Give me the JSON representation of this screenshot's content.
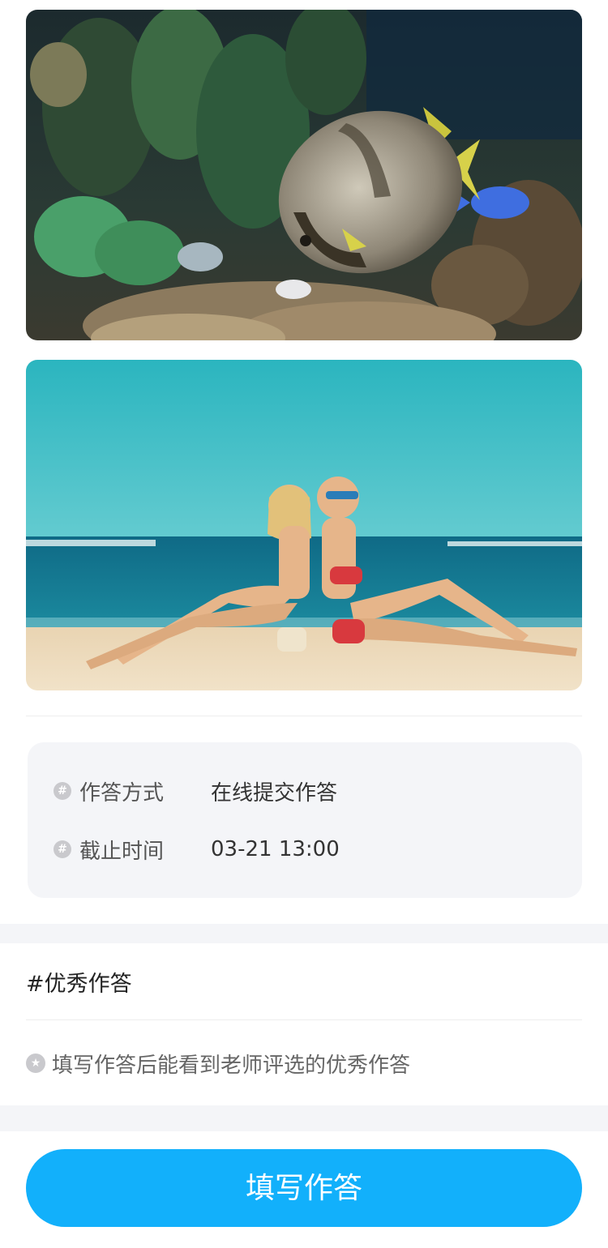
{
  "images": [
    {
      "name": "aquarium-fish-photo"
    },
    {
      "name": "beach-women-photo"
    }
  ],
  "info": {
    "rows": [
      {
        "icon": "#",
        "label": "作答方式",
        "value": "在线提交作答"
      },
      {
        "icon": "#",
        "label": "截止时间",
        "value": "03-21 13:00"
      }
    ]
  },
  "excellent": {
    "title": "#优秀作答",
    "hint_icon": "★",
    "hint": "填写作答后能看到老师评选的优秀作答"
  },
  "actions": {
    "primary_label": "填写作答"
  },
  "colors": {
    "accent": "#12b0fb",
    "card_bg": "#f4f5f8"
  }
}
